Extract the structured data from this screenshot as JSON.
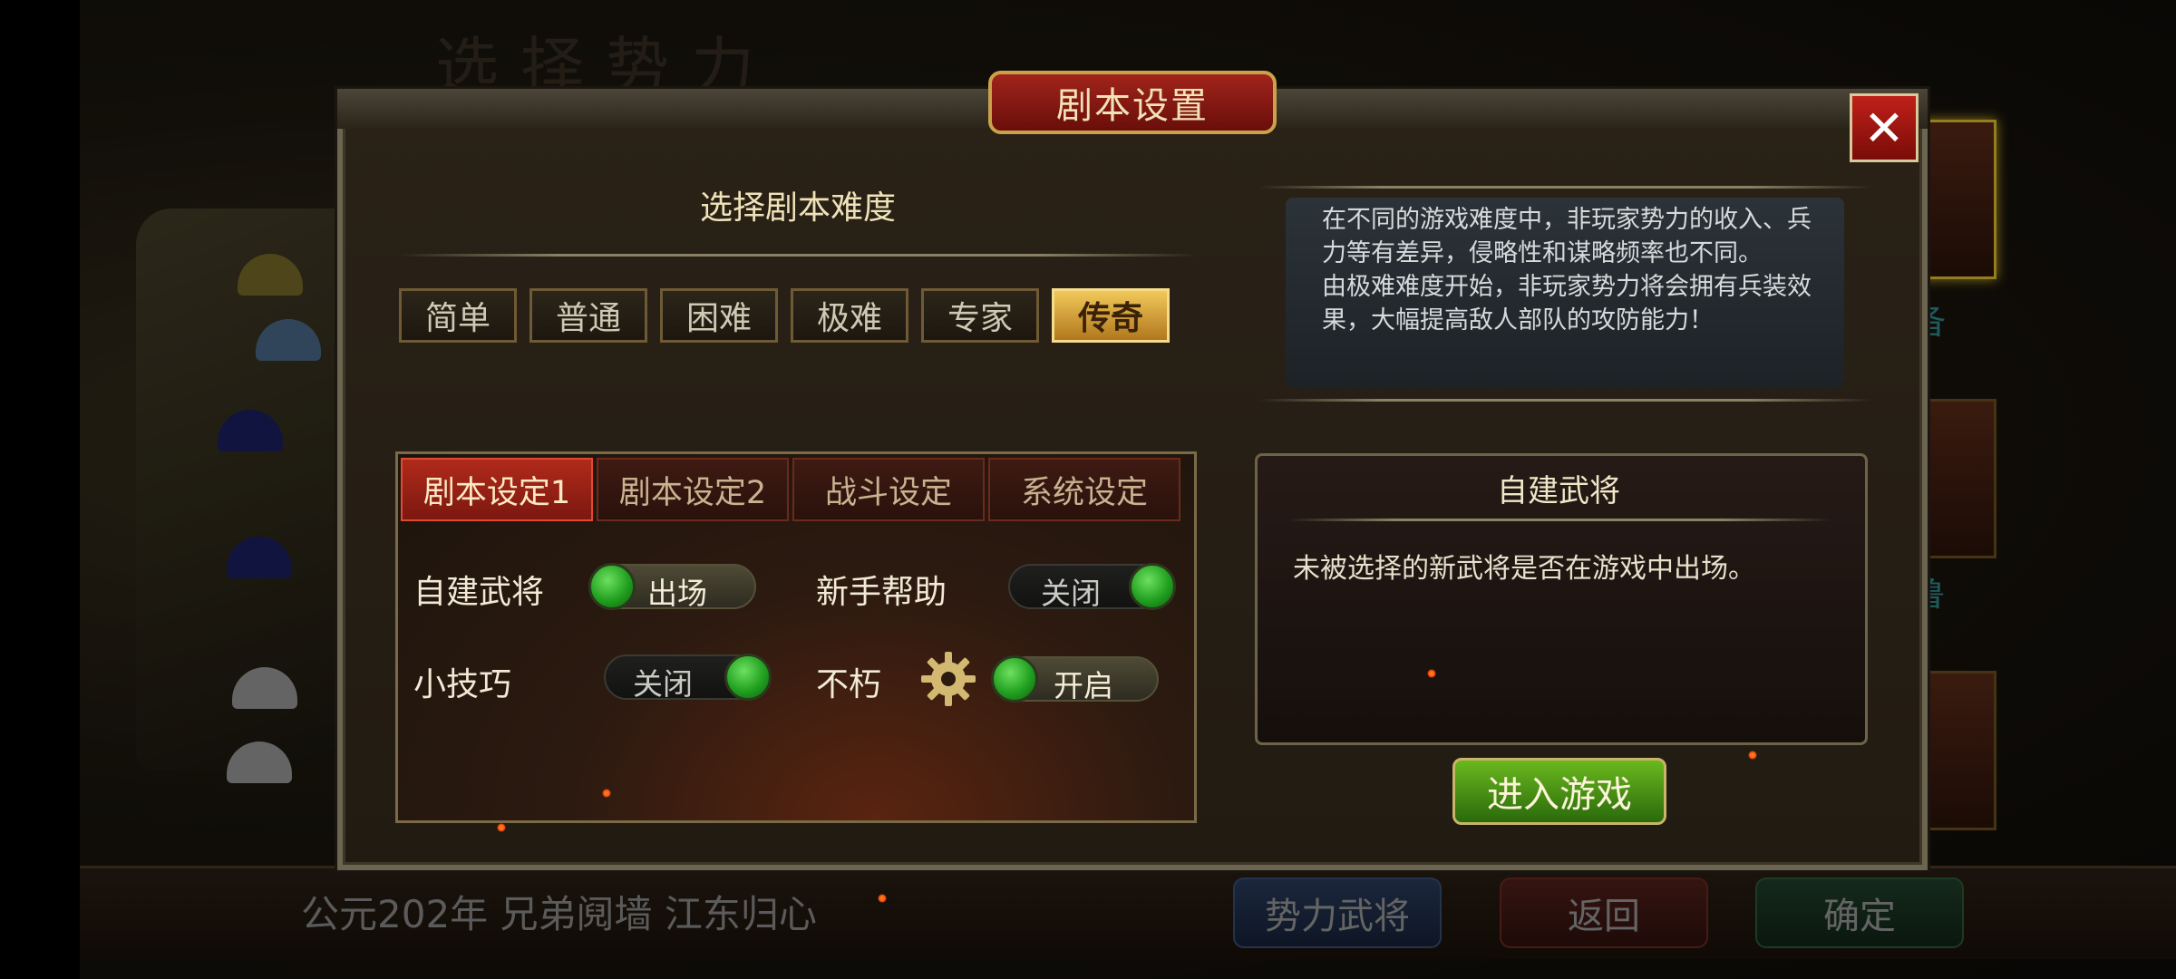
{
  "background": {
    "title": "选择势力",
    "portrait_names": [
      "备",
      "鲁"
    ],
    "bottom_caption": "公元202年 兄弟阋墙 江东归心",
    "bottom_buttons": [
      "势力武将",
      "返回",
      "确定"
    ]
  },
  "modal": {
    "title": "剧本设置",
    "close_label": "✕",
    "difficulty": {
      "heading": "选择剧本难度",
      "options": [
        "简单",
        "普通",
        "困难",
        "极难",
        "专家",
        "传奇"
      ],
      "selected": "传奇"
    },
    "info_text": [
      "在不同的游戏难度中，非玩家势力的收入、兵力等有差异，侵略性和谋略频率也不同。",
      "由极难难度开始，非玩家势力将会拥有兵装效果，大幅提高敌人部队的攻防能力！"
    ],
    "tabs": [
      "剧本设定1",
      "剧本设定2",
      "战斗设定",
      "系统设定"
    ],
    "active_tab": "剧本设定1",
    "options": [
      {
        "label": "自建武将",
        "toggle": "出场",
        "on": true
      },
      {
        "label": "新手帮助",
        "toggle": "关闭",
        "on": false
      },
      {
        "label": "小技巧",
        "toggle": "关闭",
        "on": false
      },
      {
        "label": "不朽",
        "toggle": "开启",
        "on": true
      }
    ],
    "detail": {
      "title": "自建武将",
      "description": "未被选择的新武将是否在游戏中出场。"
    },
    "enter_button": "进入游戏"
  },
  "colors": {
    "accent_gold": "#f2c85a",
    "tab_active_red": "#b02a1a",
    "toggle_green": "#22a020",
    "enter_green": "#6ab81e"
  }
}
